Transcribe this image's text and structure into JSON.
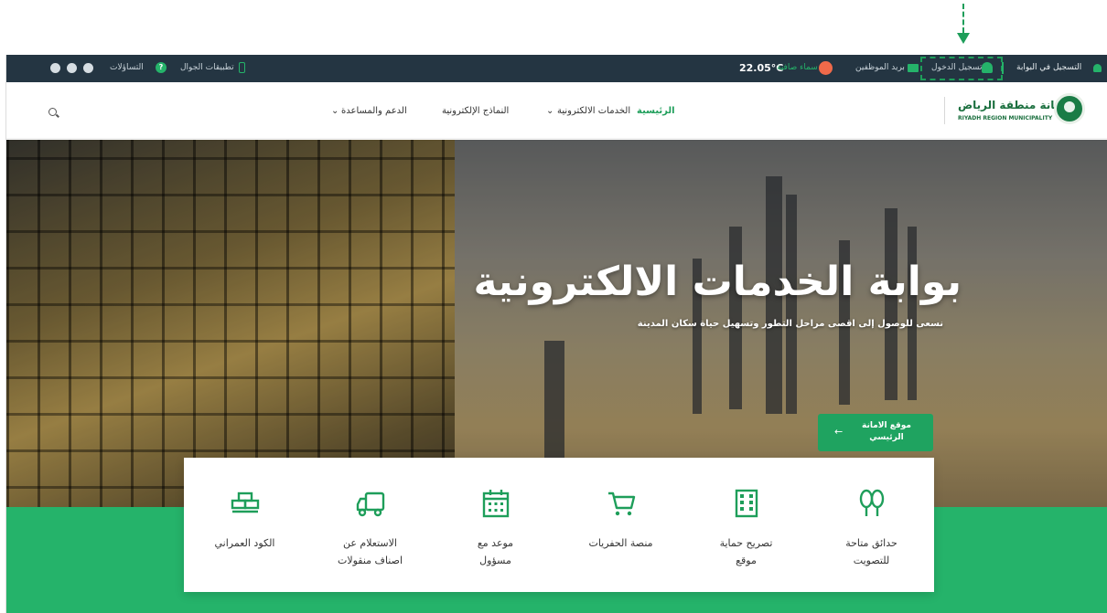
{
  "topbar": {
    "register_label": "التسجيل في البوابة",
    "login_label": "تسجيل الدخول",
    "employee_mail_label": "بريد الموظفين",
    "sky_label": "سماء صافية",
    "temperature": "22.05°C",
    "mobile_apps_label": "تطبيقات الجوال",
    "faq_label": "التساؤلات"
  },
  "brand": {
    "name_ar": "أمانة منطقة الرياض",
    "name_en": "RIYADH REGION MUNICIPALITY"
  },
  "nav": {
    "home": "الرئيسية",
    "eservices": "الخدمات الالكترونية",
    "eforms": "النماذج الإلكترونية",
    "support": "الدعم والمساعدة"
  },
  "hero": {
    "title": "بوابة الخدمات الالكترونية",
    "subtitle": "نسعى للوصول إلى اقصى مراحل التطور وتسهيل حياة سكان المدينة",
    "button_label": "موقع الامانة الرئيسي"
  },
  "services": [
    {
      "label": "حدائق متاحة\nللتصويت",
      "icon": "trees-icon"
    },
    {
      "label": "تصريح حماية\nموقع",
      "icon": "building-icon"
    },
    {
      "label": "منصة الحفريات",
      "icon": "cart-icon"
    },
    {
      "label": "موعد مع\nمسؤول",
      "icon": "calendar-icon"
    },
    {
      "label": "الاستعلام عن\nاصناف منقولات",
      "icon": "truck-icon"
    },
    {
      "label": "الكود العمراني",
      "icon": "bricks-icon"
    }
  ],
  "colors": {
    "brand_green": "#25b36a",
    "topbar_bg": "#243542"
  }
}
